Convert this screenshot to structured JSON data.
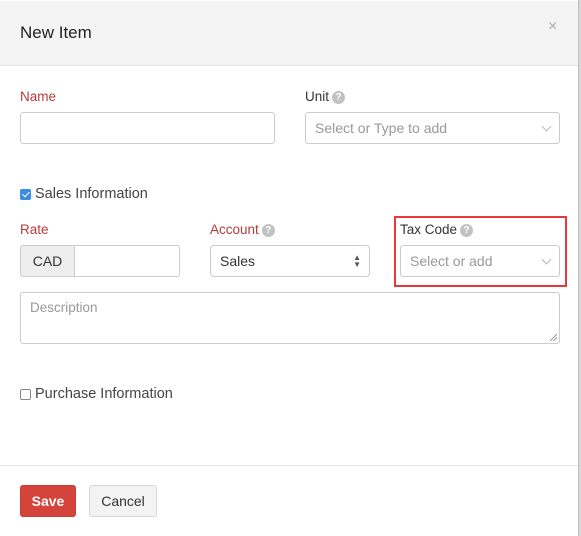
{
  "dialog": {
    "title": "New Item",
    "close_icon": "×"
  },
  "fields": {
    "name": {
      "label": "Name",
      "value": ""
    },
    "unit": {
      "label": "Unit",
      "placeholder": "Select or Type to add",
      "help_icon": "?"
    },
    "sales_information": {
      "label": "Sales Information",
      "checked": true
    },
    "rate": {
      "label": "Rate",
      "currency": "CAD",
      "value": ""
    },
    "account": {
      "label": "Account",
      "value": "Sales",
      "help_icon": "?"
    },
    "tax_code": {
      "label": "Tax Code",
      "placeholder": "Select or add",
      "help_icon": "?"
    },
    "description": {
      "placeholder": "Description",
      "value": ""
    },
    "purchase_information": {
      "label": "Purchase Information",
      "checked": false
    }
  },
  "footer": {
    "save_label": "Save",
    "cancel_label": "Cancel"
  },
  "colors": {
    "required_label": "#b53a3a",
    "save_button": "#d5443a",
    "highlight_border": "#e8383d",
    "checkbox_checked": "#3b8de0"
  }
}
